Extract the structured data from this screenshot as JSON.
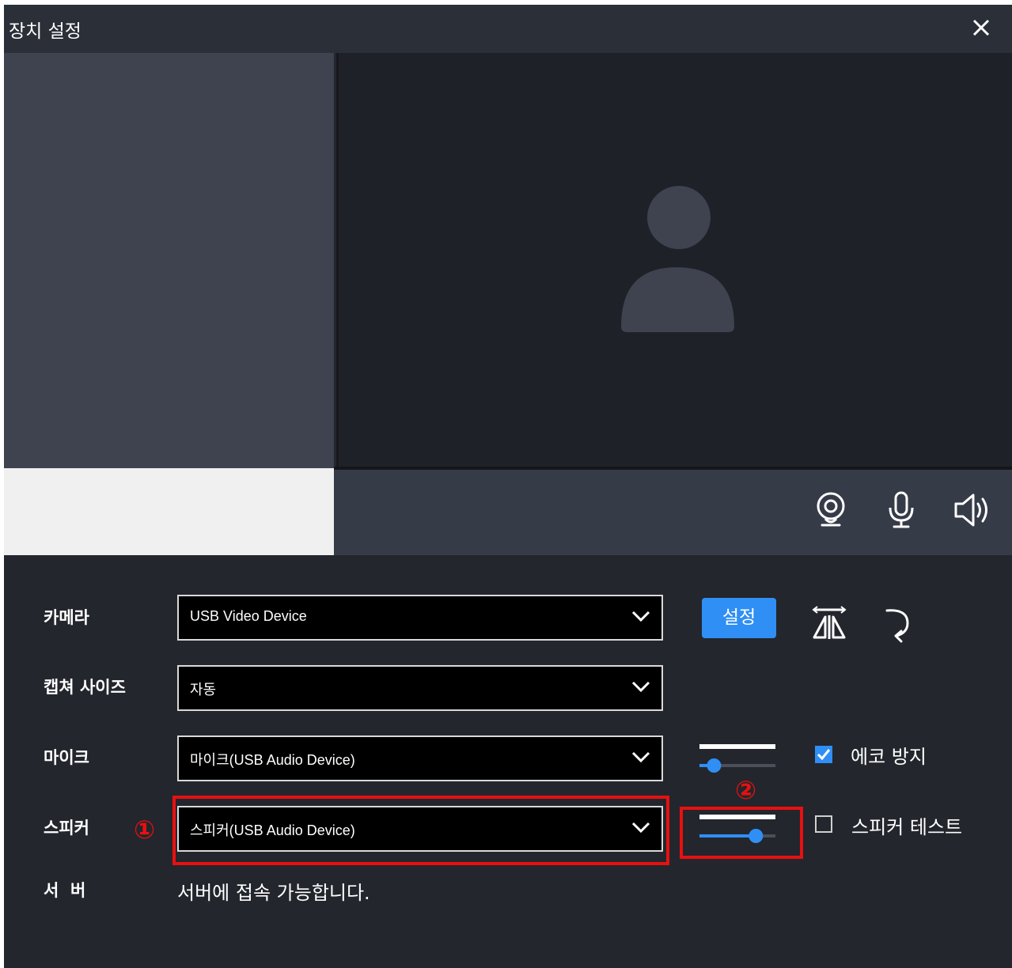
{
  "window": {
    "title": "장치 설정",
    "close_icon": "close-icon"
  },
  "device_bar": {
    "icons": [
      "webcam-icon",
      "microphone-icon",
      "speaker-icon"
    ]
  },
  "settings": {
    "camera": {
      "label": "카메라",
      "value": "USB Video Device"
    },
    "capture_size": {
      "label": "캡쳐 사이즈",
      "value": "자동"
    },
    "mic": {
      "label": "마이크",
      "value": "마이크(USB Audio Device)",
      "level": 0.1
    },
    "speaker": {
      "label": "스피커",
      "value": "스피커(USB Audio Device)",
      "level": 0.73
    },
    "server": {
      "label": "서  버",
      "status": "서버에 접속 가능합니다."
    }
  },
  "camera_tools": {
    "settings_label": "설정",
    "icons": [
      "mirror-flip-icon",
      "rotate-icon"
    ]
  },
  "options": {
    "echo_cancel": {
      "label": "에코 방지",
      "checked": true
    },
    "speaker_test": {
      "label": "스피커 테스트",
      "checked": false
    }
  },
  "annotations": {
    "marker_1": "①",
    "marker_2": "②"
  },
  "colors": {
    "accent": "#2f8ff5",
    "highlight": "#e81010"
  }
}
